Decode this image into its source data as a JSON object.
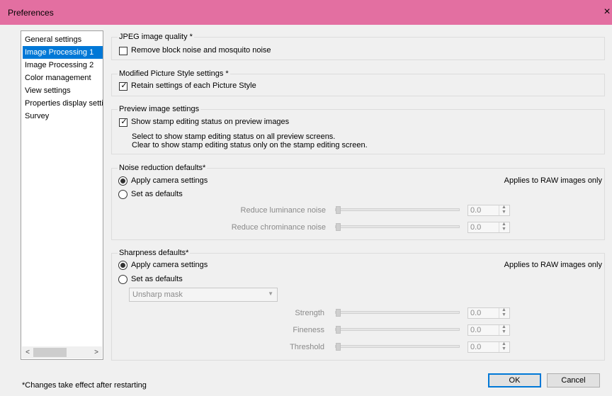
{
  "window": {
    "title": "Preferences",
    "close_glyph": "×"
  },
  "sidebar": {
    "items": [
      {
        "label": "General settings",
        "selected": false
      },
      {
        "label": "Image Processing 1",
        "selected": true
      },
      {
        "label": "Image Processing 2",
        "selected": false
      },
      {
        "label": "Color management",
        "selected": false
      },
      {
        "label": "View settings",
        "selected": false
      },
      {
        "label": "Properties display settings",
        "selected": false
      },
      {
        "label": "Survey",
        "selected": false
      }
    ],
    "scroll_left": "<",
    "scroll_right": ">"
  },
  "jpeg": {
    "legend": "JPEG image quality *",
    "remove_noise": {
      "label": "Remove block noise and mosquito noise",
      "checked": false
    }
  },
  "picture_style": {
    "legend": "Modified Picture Style settings *",
    "retain": {
      "label": "Retain settings of each Picture Style",
      "checked": true
    }
  },
  "preview": {
    "legend": "Preview image settings",
    "show_stamp": {
      "label": "Show stamp editing status on preview images",
      "checked": true
    },
    "help_line1": "Select to show stamp editing status on all preview screens.",
    "help_line2": "Clear to show stamp editing status only on the stamp editing screen."
  },
  "noise": {
    "legend": "Noise reduction defaults*",
    "apply_camera": {
      "label": "Apply camera settings",
      "selected": true
    },
    "set_defaults": {
      "label": "Set as defaults",
      "selected": false
    },
    "note": "Applies to RAW images only",
    "luminance": {
      "label": "Reduce luminance noise",
      "value": "0.0"
    },
    "chrominance": {
      "label": "Reduce chrominance noise",
      "value": "0.0"
    }
  },
  "sharpness": {
    "legend": "Sharpness defaults*",
    "apply_camera": {
      "label": "Apply camera settings",
      "selected": true
    },
    "set_defaults": {
      "label": "Set as defaults",
      "selected": false
    },
    "note": "Applies to RAW images only",
    "mode": "Unsharp mask",
    "strength": {
      "label": "Strength",
      "value": "0.0"
    },
    "fineness": {
      "label": "Fineness",
      "value": "0.0"
    },
    "threshold": {
      "label": "Threshold",
      "value": "0.0"
    }
  },
  "footer": {
    "note": "*Changes take effect after restarting",
    "ok": "OK",
    "cancel": "Cancel"
  },
  "colors": {
    "titlebar": "#e36fa1",
    "selection": "#0078d7"
  }
}
